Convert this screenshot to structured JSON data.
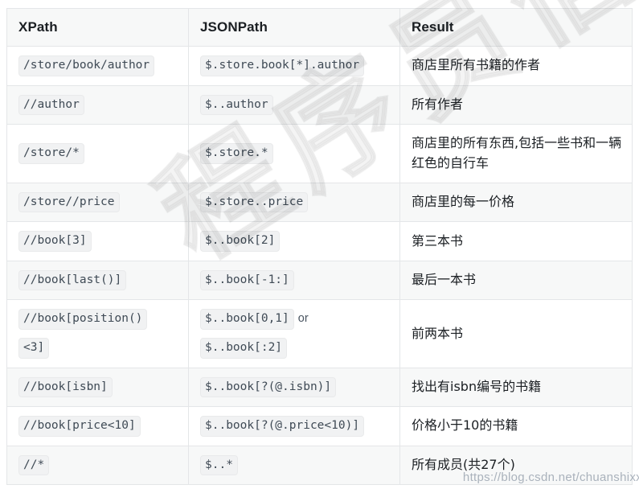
{
  "table": {
    "columns": [
      {
        "key": "xpath",
        "label": "XPath"
      },
      {
        "key": "jsonpath",
        "label": "JSONPath"
      },
      {
        "key": "result",
        "label": "Result"
      }
    ],
    "rows": [
      {
        "xpath": [
          "/store/book/author"
        ],
        "jsonpath": [
          "$.store.book[*].author"
        ],
        "jsonpath_join": "",
        "result": "商店里所有书籍的作者"
      },
      {
        "xpath": [
          "//author"
        ],
        "jsonpath": [
          "$..author"
        ],
        "jsonpath_join": "",
        "result": "所有作者"
      },
      {
        "xpath": [
          "/store/*"
        ],
        "jsonpath": [
          "$.store.*"
        ],
        "jsonpath_join": "",
        "result": "商店里的所有东西,包括一些书和一辆红色的自行车"
      },
      {
        "xpath": [
          "/store//price"
        ],
        "jsonpath": [
          "$.store..price"
        ],
        "jsonpath_join": "",
        "result": "商店里的每一价格"
      },
      {
        "xpath": [
          "//book[3]"
        ],
        "jsonpath": [
          "$..book[2]"
        ],
        "jsonpath_join": "",
        "result": "第三本书"
      },
      {
        "xpath": [
          "//book[last()]"
        ],
        "jsonpath": [
          "$..book[-1:]"
        ],
        "jsonpath_join": "",
        "result": "最后一本书"
      },
      {
        "xpath": [
          "//book[position()",
          "<3]"
        ],
        "jsonpath": [
          "$..book[0,1]",
          "$..book[:2]"
        ],
        "jsonpath_join": "or",
        "result": "前两本书"
      },
      {
        "xpath": [
          "//book[isbn]"
        ],
        "jsonpath": [
          "$..book[?(@.isbn)]"
        ],
        "jsonpath_join": "",
        "result": "找出有isbn编号的书籍"
      },
      {
        "xpath": [
          "//book[price<10]"
        ],
        "jsonpath": [
          "$..book[?(@.price<10)]"
        ],
        "jsonpath_join": "",
        "result": "价格小于10的书籍"
      },
      {
        "xpath": [
          "//*"
        ],
        "jsonpath": [
          "$..*"
        ],
        "jsonpath_join": "",
        "result": "所有成员(共27个)"
      }
    ]
  },
  "watermark": {
    "diagonal_text": "程序员信技术",
    "url": "https://blog.csdn.net/chuanshixx"
  },
  "colors": {
    "header_bg": "#f7f8f8",
    "row_alt_bg": "#f7f8f8",
    "border": "#e4e6e8",
    "chip_bg": "#f1f2f3",
    "text": "#1b1f23",
    "code_text": "#3f4a55",
    "watermark": "#f0f0f0"
  }
}
